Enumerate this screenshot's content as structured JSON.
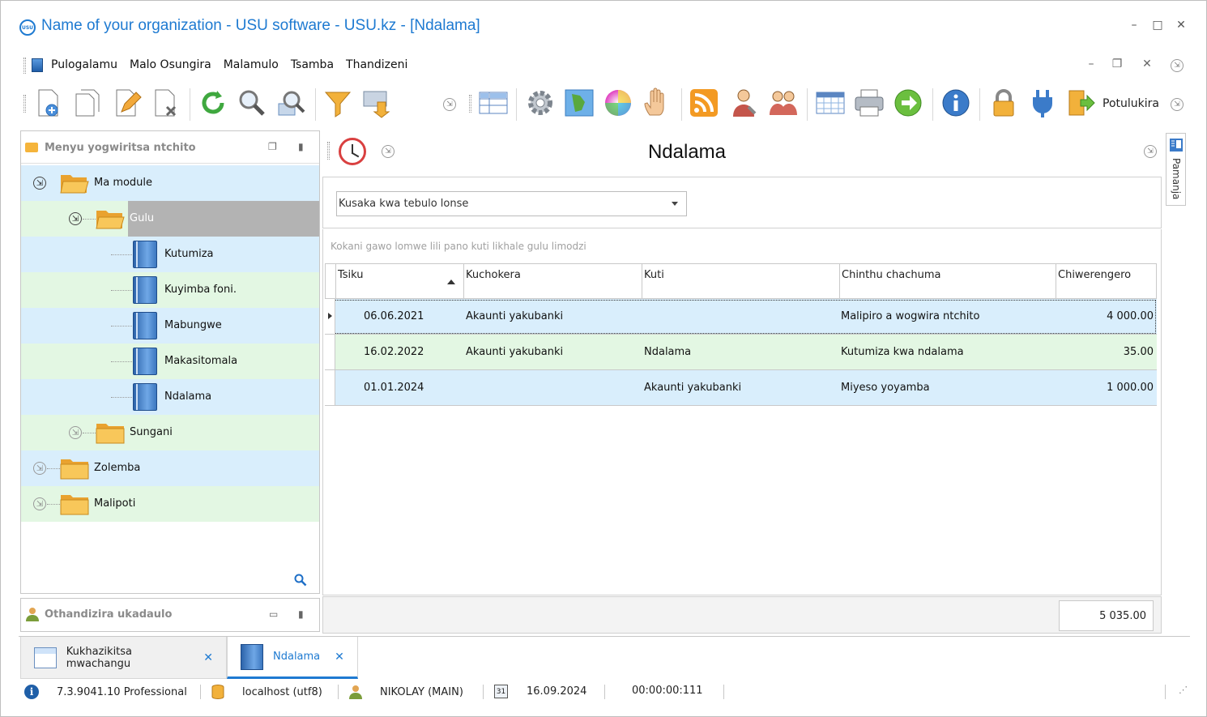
{
  "window": {
    "title": "Name of your organization - USU software - USU.kz - [Ndalama]",
    "logo_text": "USU",
    "minimize": "–",
    "maximize": "□",
    "close": "✕"
  },
  "menu": {
    "items": [
      "Pulogalamu",
      "Malo Osungira",
      "Malamulo",
      "Tsamba",
      "Thandizeni"
    ]
  },
  "toolbar": {
    "exit_label": "Potulukira",
    "icons": [
      "add-icon",
      "copy-icon",
      "edit-icon",
      "delete-icon",
      "refresh-icon",
      "search-icon",
      "advanced-search-icon",
      "filter-icon",
      "export-icon",
      "layout-icon",
      "settings-icon",
      "map-icon",
      "color-icon",
      "hand-icon",
      "rss-icon",
      "user-icon",
      "users-icon",
      "table-icon",
      "print-icon",
      "forward-icon",
      "info-icon",
      "lock-icon",
      "plugin-icon",
      "exit-icon"
    ]
  },
  "left_panel": {
    "title": "Menyu yogwiritsa ntchito",
    "tree": [
      {
        "label": "Ma module",
        "level": 0
      },
      {
        "label": "Gulu",
        "level": 1
      },
      {
        "label": "Kutumiza",
        "level": 2
      },
      {
        "label": "Kuyimba foni.",
        "level": 2
      },
      {
        "label": "Mabungwe",
        "level": 2
      },
      {
        "label": "Makasitomala",
        "level": 2
      },
      {
        "label": "Ndalama",
        "level": 2
      },
      {
        "label": "Sungani",
        "level": 1
      },
      {
        "label": "Zolemba",
        "level": 0
      },
      {
        "label": "Malipoti",
        "level": 0
      }
    ]
  },
  "left_panel2": {
    "title": "Othandizira ukadaulo"
  },
  "right_tab": {
    "label": "Pamanja"
  },
  "main": {
    "title": "Ndalama",
    "filter_combo": "Kusaka kwa tebulo lonse",
    "group_hint": "Kokani gawo lomwe lili pano kuti likhale gulu limodzi",
    "columns": [
      "Tsiku",
      "Kuchokera",
      "Kuti",
      "Chinthu chachuma",
      "Chiwerengero"
    ],
    "rows": [
      [
        "06.06.2021",
        "Akaunti yakubanki",
        "",
        "Malipiro a wogwira ntchito",
        "4 000.00"
      ],
      [
        "16.02.2022",
        "Akaunti yakubanki",
        "Ndalama",
        "Kutumiza kwa ndalama",
        "35.00"
      ],
      [
        "01.01.2024",
        "",
        "Akaunti yakubanki",
        "Miyeso yoyamba",
        "1 000.00"
      ]
    ],
    "total": "5 035.00"
  },
  "tabs": [
    {
      "label": "Kukhazikitsa mwachangu",
      "close": "✕"
    },
    {
      "label": "Ndalama",
      "close": "✕"
    }
  ],
  "status": {
    "version": "7.3.9041.10 Professional",
    "db": "localhost (utf8)",
    "user": "NIKOLAY (MAIN)",
    "calendar_day": "31",
    "date": "16.09.2024",
    "timer": "00:00:00:111"
  },
  "colors": {
    "accent": "#1e7ad1",
    "row_blue": "#d9eefc",
    "row_green": "#e3f7e3",
    "selected": "#b3b3b3"
  }
}
